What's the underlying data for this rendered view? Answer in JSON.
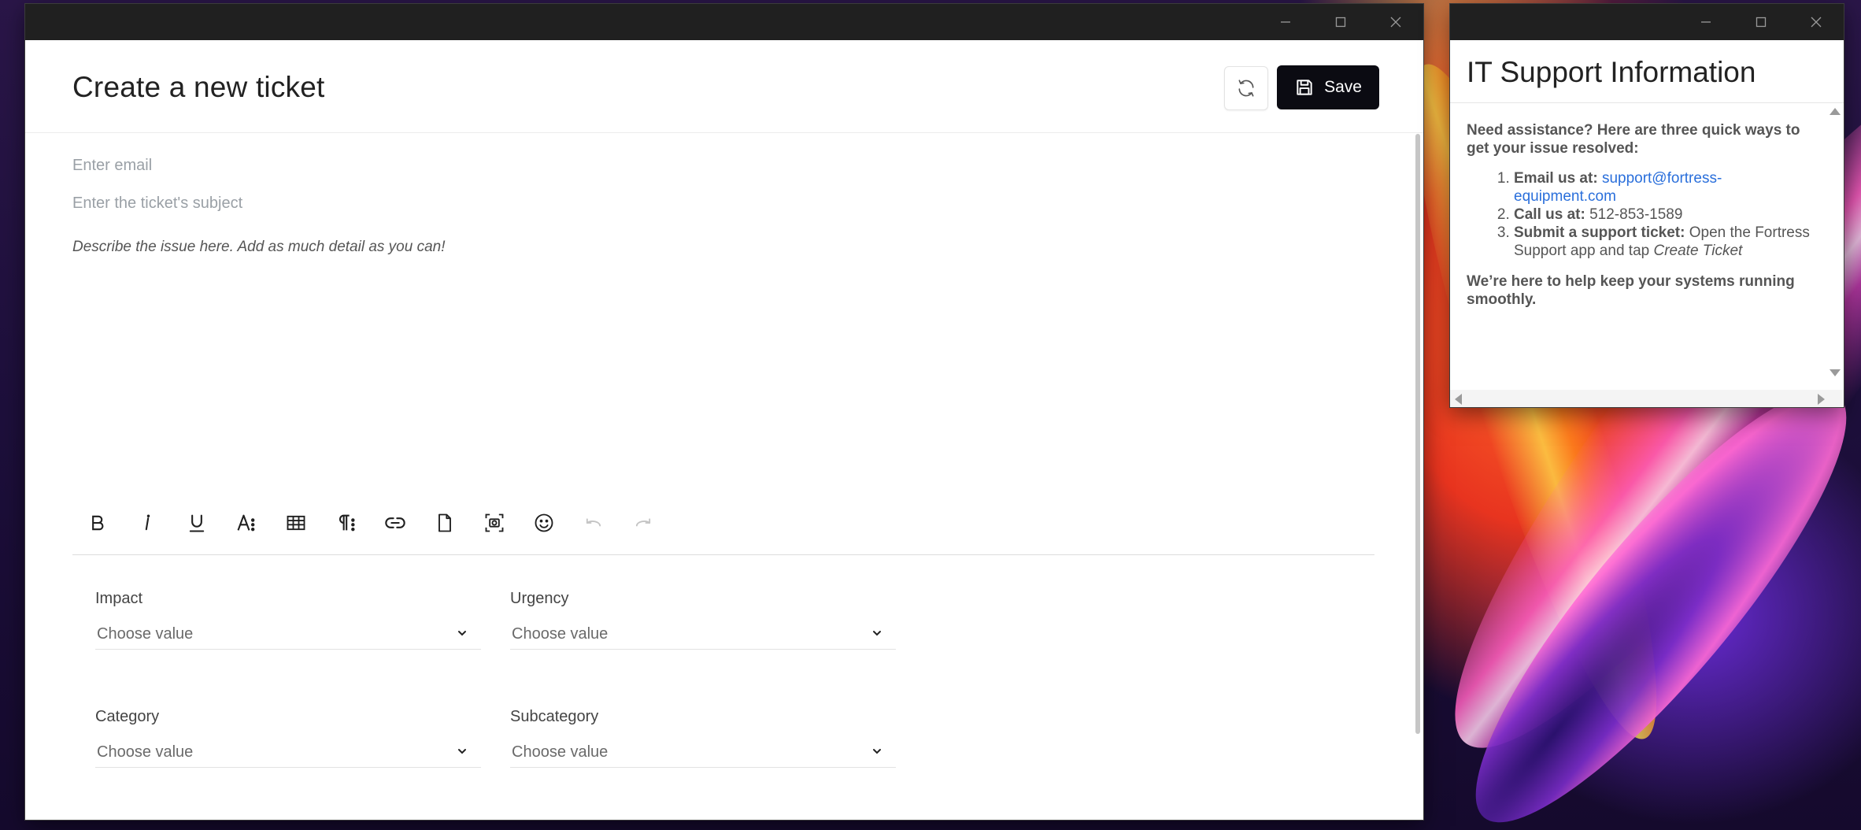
{
  "main_window": {
    "title": "Create a new ticket",
    "save_label": "Save",
    "email_placeholder": "Enter email",
    "subject_placeholder": "Enter the ticket's subject",
    "description_placeholder": "Describe the issue here. Add as much detail as you can!",
    "toolbar": [
      "bold",
      "italic",
      "underline",
      "font-size",
      "table",
      "paragraph-format",
      "link",
      "attach-file",
      "screenshot",
      "emoji",
      "undo",
      "redo"
    ],
    "fields": {
      "impact": {
        "label": "Impact",
        "value": "Choose value"
      },
      "urgency": {
        "label": "Urgency",
        "value": "Choose value"
      },
      "category": {
        "label": "Category",
        "value": "Choose value"
      },
      "subcategory": {
        "label": "Subcategory",
        "value": "Choose value"
      }
    }
  },
  "info_window": {
    "title": "IT Support Information",
    "lead": "Need assistance? Here are three quick ways to get your issue resolved:",
    "items": [
      {
        "label": "Email us at:",
        "value": "support@fortress-equipment.com"
      },
      {
        "label": "Call us at:",
        "value": "512-853-1589"
      },
      {
        "label": "Submit a support ticket:",
        "value": "Open the Fortress Support app and tap",
        "emphasis": "Create Ticket"
      }
    ],
    "closing": "We’re here to help keep your systems running smoothly."
  },
  "colors": {
    "save_button_bg": "#0b0b12",
    "link": "#2a6fdb",
    "titlebar": "#202020"
  }
}
